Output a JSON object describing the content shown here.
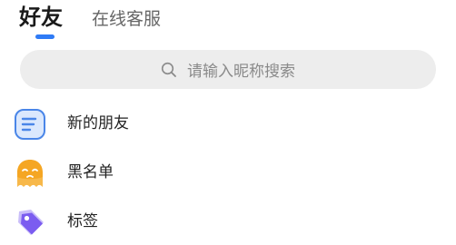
{
  "tabs": [
    {
      "label": "好友",
      "active": true
    },
    {
      "label": "在线客服",
      "active": false
    }
  ],
  "search": {
    "placeholder": "请输入昵称搜索",
    "icon": "search-icon"
  },
  "items": [
    {
      "label": "新的朋友",
      "icon": "new-friends-icon"
    },
    {
      "label": "黑名单",
      "icon": "blacklist-icon"
    },
    {
      "label": "标签",
      "icon": "tag-icon"
    }
  ],
  "colors": {
    "accent": "#2f7bf6",
    "search_bg": "#ededed",
    "blacklist_icon": "#f5a623",
    "tag_icon": "#7b5cf0",
    "new_friends_icon": "#4a86e8"
  }
}
